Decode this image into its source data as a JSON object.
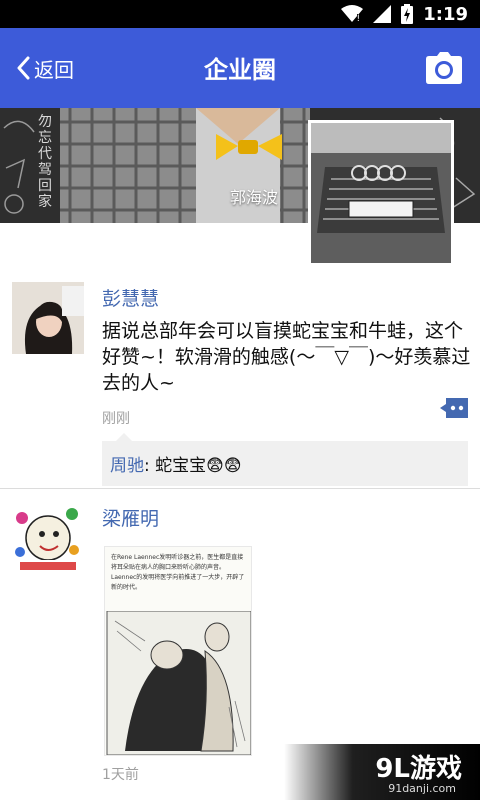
{
  "status_bar": {
    "time": "1:19"
  },
  "app_bar": {
    "back_label": "返回",
    "title": "企业圈"
  },
  "cover": {
    "chalk_text": "勿忘代驾回家",
    "username": "郭海波"
  },
  "posts": [
    {
      "author": "彭慧慧",
      "content": "据说总部年会可以盲摸蛇宝宝和牛蛙，这个好赞~！软滑滑的触感(～￣▽￣)～好羡慕过去的人~",
      "time": "刚刚",
      "comments": [
        {
          "author": "周驰",
          "separator": ": ",
          "text": "蛇宝宝😨😨"
        }
      ]
    },
    {
      "author": "梁雁明",
      "time": "1天前",
      "image_text": "在Rene Laennec发明听诊器之前，医生都是直接将耳朵贴在病人的胸口来聆听心肺的声音。Laennec的发明将医学向前推进了一大步，开辟了新的时代。"
    }
  ],
  "watermark": {
    "brand": "9L游戏",
    "site": "91danji.com"
  },
  "colors": {
    "accent": "#3d5bd9",
    "name_link": "#4469b1"
  }
}
